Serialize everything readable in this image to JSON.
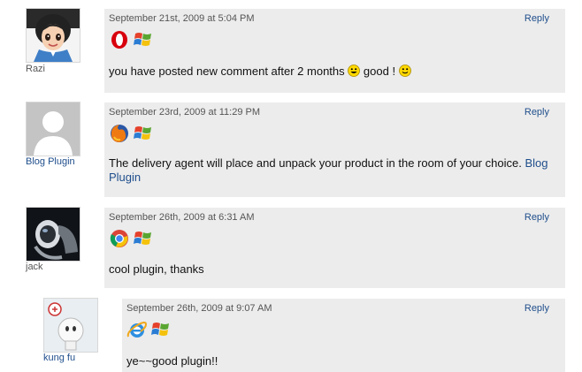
{
  "comments": [
    {
      "author": "Razi",
      "author_is_link": false,
      "date": "September 21st, 2009 at 5:04 PM",
      "reply": "Reply",
      "browser_icon": "opera-icon",
      "os_icon": "windows-icon",
      "text_before": "you have posted new comment after 2 months",
      "text_middle": "good !",
      "smileys": [
        "grin-smiley-icon",
        "smile-smiley-icon"
      ]
    },
    {
      "author": "Blog Plugin",
      "author_is_link": true,
      "date": "September 23rd, 2009 at 11:29 PM",
      "reply": "Reply",
      "browser_icon": "firefox-icon",
      "os_icon": "windows-icon",
      "text": "The delivery agent will place and unpack your product in the room of your choice.",
      "link_text": "Blog Plugin"
    },
    {
      "author": "jack",
      "author_is_link": false,
      "date": "September 26th, 2009 at 6:31 AM",
      "reply": "Reply",
      "browser_icon": "chrome-icon",
      "os_icon": "windows-icon",
      "text": "cool plugin, thanks"
    },
    {
      "author": "kung fu",
      "author_is_link": true,
      "date": "September 26th, 2009 at 9:07 AM",
      "reply": "Reply",
      "browser_icon": "internet-explorer-icon",
      "os_icon": "windows-icon",
      "text": "ye~~good plugin!!"
    }
  ]
}
